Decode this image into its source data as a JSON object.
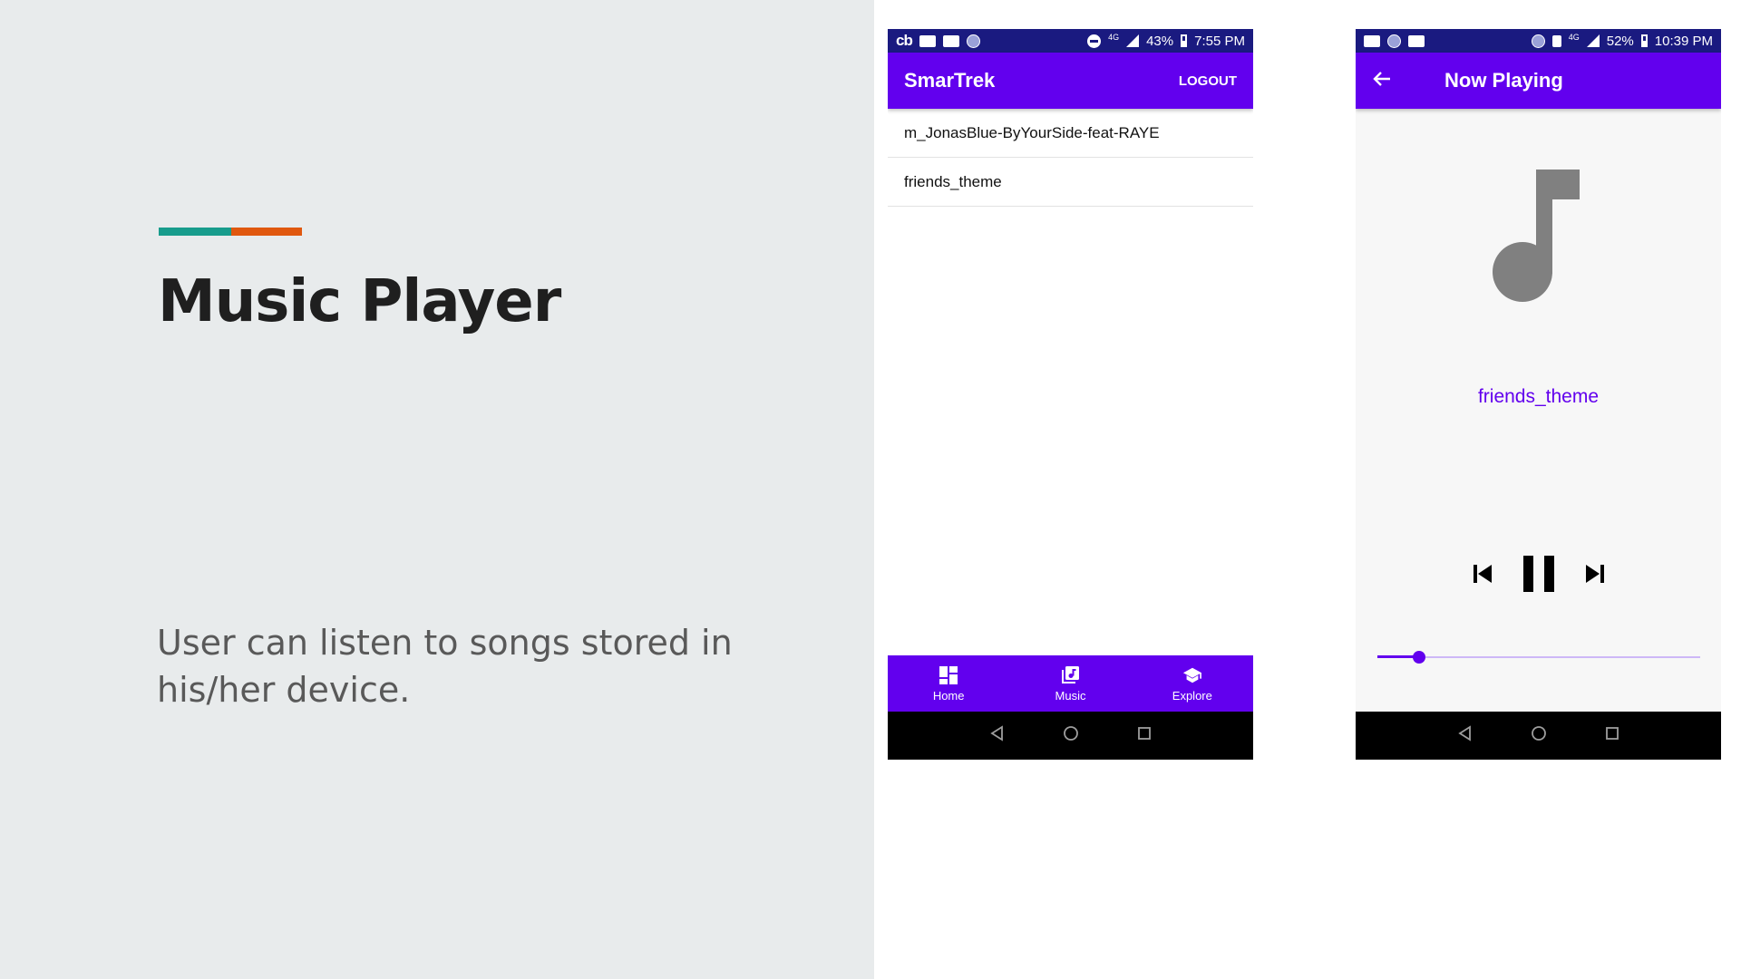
{
  "slide": {
    "title": "Music Player",
    "description": "User can listen to songs stored in his/her device.",
    "accent_colors": [
      "#179c8c",
      "#e0580f"
    ]
  },
  "phone_library": {
    "status_bar": {
      "left_app_label": "cb",
      "network_badge": "4G",
      "battery": "43%",
      "time": "7:55 PM"
    },
    "app_bar": {
      "title": "SmarTrek",
      "action_label": "LOGOUT"
    },
    "songs": [
      {
        "title": "m_JonasBlue-ByYourSide-feat-RAYE"
      },
      {
        "title": "friends_theme"
      }
    ],
    "bottom_nav": [
      {
        "label": "Home",
        "icon": "dashboard-icon"
      },
      {
        "label": "Music",
        "icon": "library-music-icon"
      },
      {
        "label": "Explore",
        "icon": "school-icon"
      }
    ],
    "system_nav": [
      "back-icon",
      "home-icon",
      "recents-icon"
    ]
  },
  "phone_now_playing": {
    "status_bar": {
      "network_badge": "4G",
      "battery": "52%",
      "time": "10:39 PM"
    },
    "app_bar": {
      "title": "Now Playing"
    },
    "track_name": "friends_theme",
    "controls": [
      "skip-previous-icon",
      "pause-icon",
      "skip-next-icon"
    ],
    "seek_progress": 0.13,
    "system_nav": [
      "back-icon",
      "home-icon",
      "recents-icon"
    ]
  },
  "colors": {
    "primary": "#6200ee",
    "status_bar": "#1a1a80",
    "album_art": "#808080"
  }
}
